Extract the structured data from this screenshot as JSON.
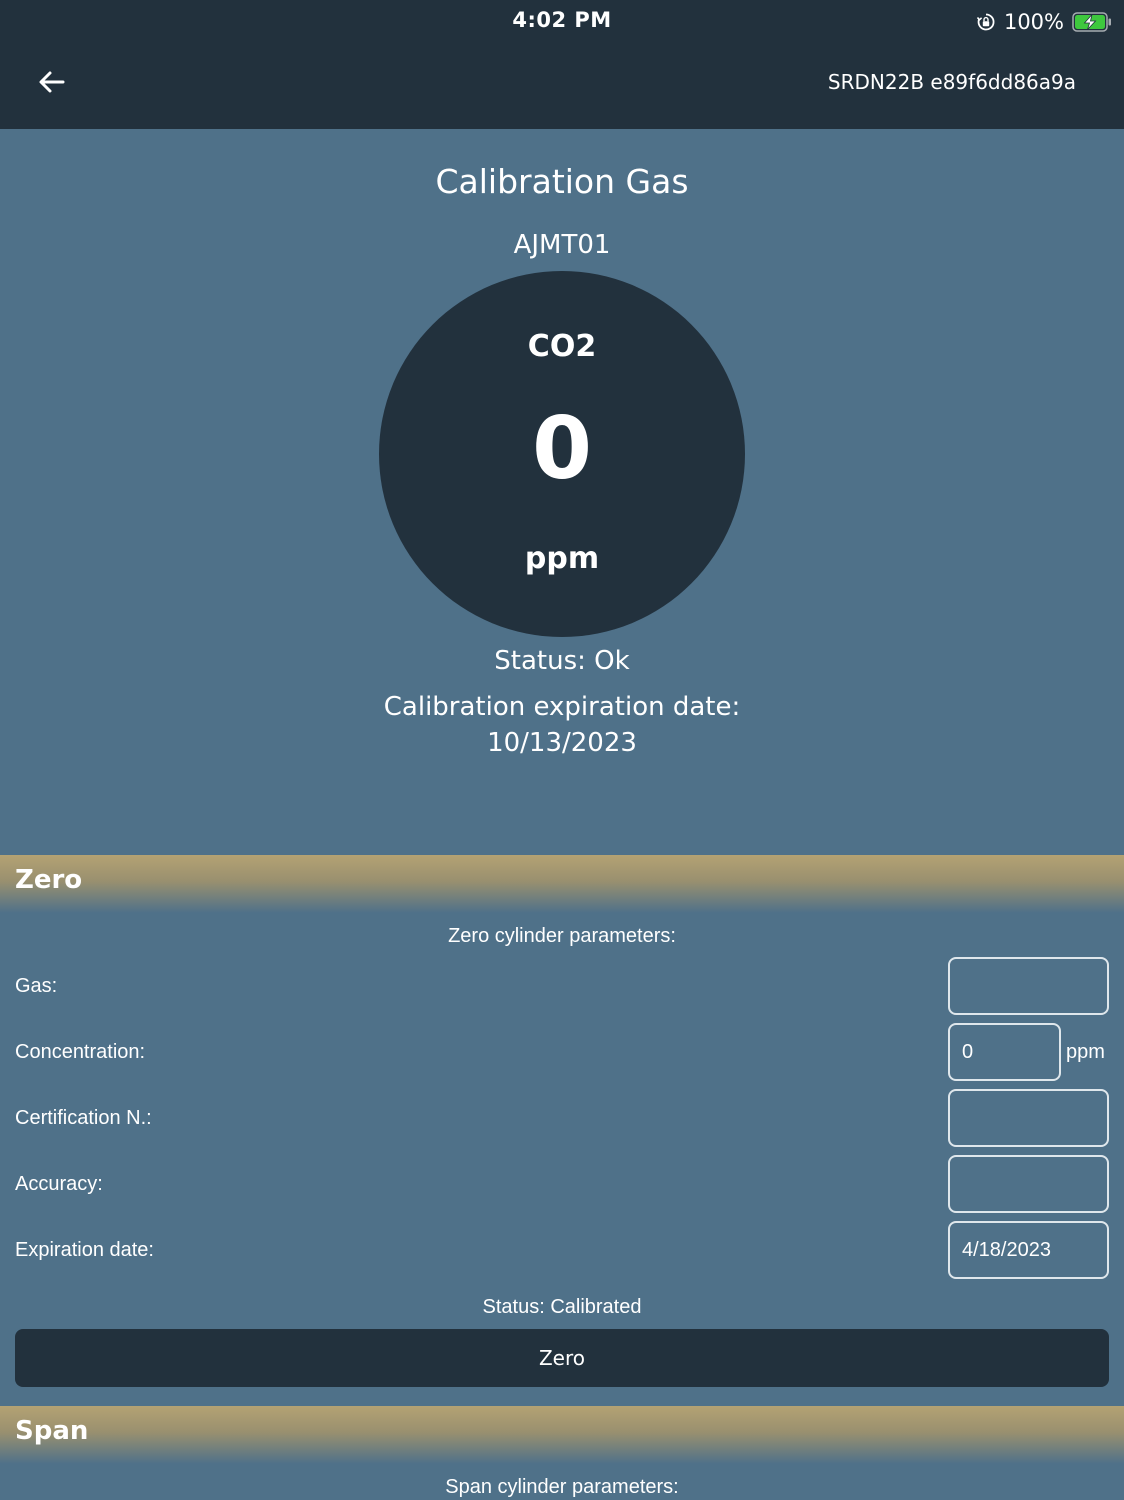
{
  "status_bar": {
    "time": "4:02 PM",
    "battery_percent": "100%",
    "battery_level": 1.0,
    "icons": [
      "rotation-lock-icon",
      "battery-charging-icon"
    ]
  },
  "header": {
    "back_icon": "arrow-left-icon",
    "device_id": "SRDN22B e89f6dd86a9a"
  },
  "sensor": {
    "page_title": "Calibration Gas",
    "name": "AJMT01",
    "gas": "CO2",
    "value": "0",
    "unit": "ppm",
    "status": "Status: Ok",
    "expiration_label": "Calibration expiration date:",
    "expiration_date": "10/13/2023"
  },
  "zero": {
    "title": "Zero",
    "subheading": "Zero cylinder parameters:",
    "gas_label": "Gas:",
    "gas_value": "",
    "concentration_label": "Concentration:",
    "concentration_value": "0",
    "concentration_unit": "ppm",
    "certification_label": "Certification N.:",
    "certification_value": "",
    "accuracy_label": "Accuracy:",
    "accuracy_value": "",
    "expiration_label": "Expiration date:",
    "expiration_value": "4/18/2023",
    "status": "Status: Calibrated",
    "button_label": "Zero"
  },
  "span": {
    "title": "Span",
    "subheading": "Span cylinder parameters:"
  },
  "colors": {
    "background": "#4f7189",
    "dark": "#22313d",
    "section_header": "#b4a273",
    "battery_green": "#3ec83e"
  }
}
